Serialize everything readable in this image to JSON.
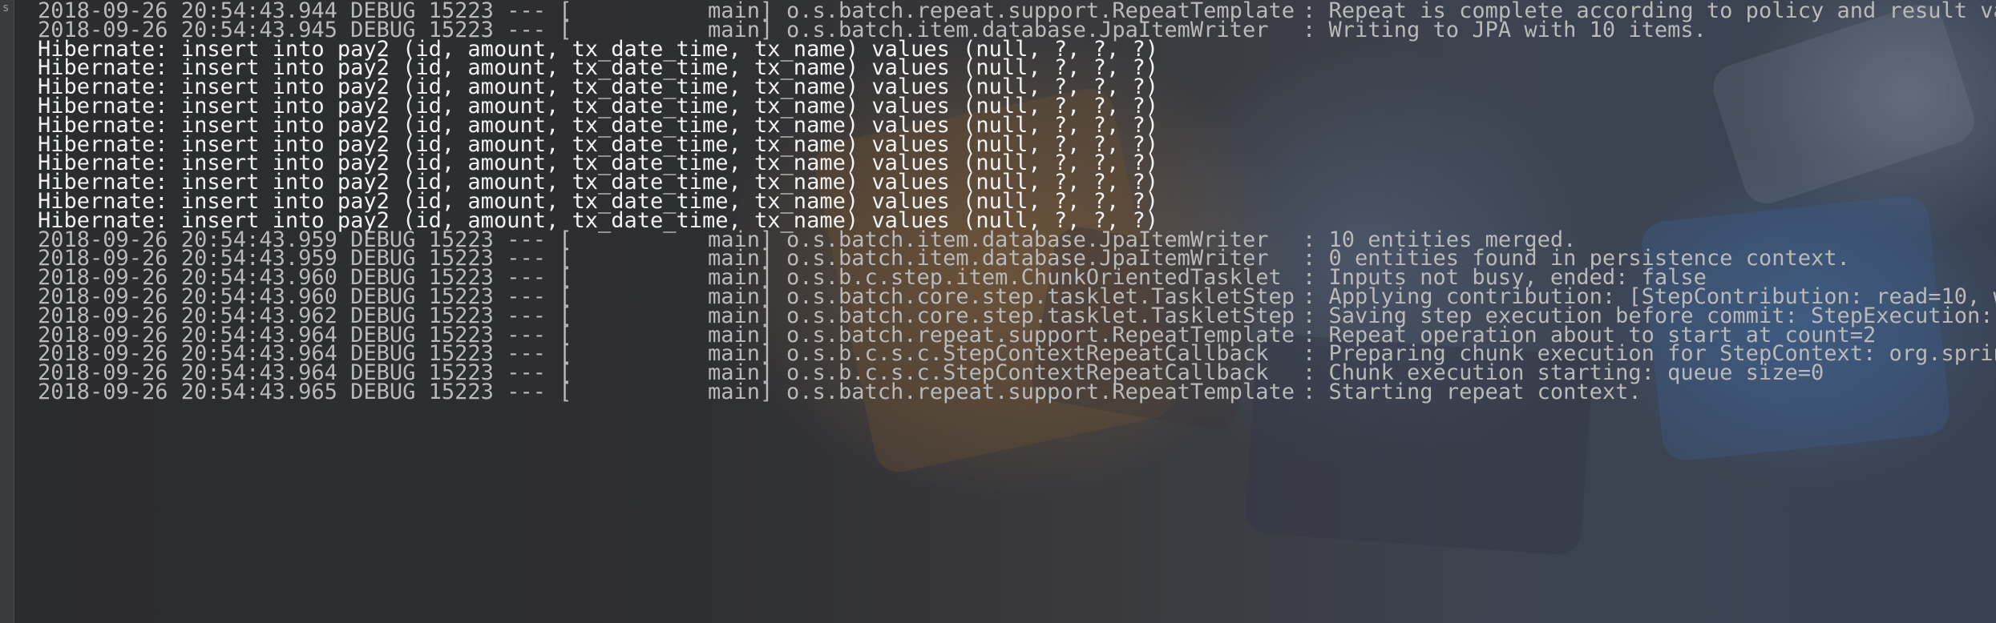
{
  "gutter": {
    "label": "s"
  },
  "log_lines": [
    {
      "kind": "log",
      "prefix": "2018-09-26 20:54:43.944 DEBUG 15223 --- [",
      "thread": "main]",
      "logger": "o.s.batch.repeat.support.RepeatTemplate",
      "message": ": Repeat is complete according to policy and result va"
    },
    {
      "kind": "log",
      "prefix": "2018-09-26 20:54:43.945 DEBUG 15223 --- [",
      "thread": "main]",
      "logger": "o.s.batch.item.database.JpaItemWriter",
      "message": ": Writing to JPA with 10 items."
    },
    {
      "kind": "sql",
      "text": "Hibernate: insert into pay2 (id, amount, tx_date_time, tx_name) values (null, ?, ?, ?)"
    },
    {
      "kind": "sql",
      "text": "Hibernate: insert into pay2 (id, amount, tx_date_time, tx_name) values (null, ?, ?, ?)"
    },
    {
      "kind": "sql",
      "text": "Hibernate: insert into pay2 (id, amount, tx_date_time, tx_name) values (null, ?, ?, ?)"
    },
    {
      "kind": "sql",
      "text": "Hibernate: insert into pay2 (id, amount, tx_date_time, tx_name) values (null, ?, ?, ?)"
    },
    {
      "kind": "sql",
      "text": "Hibernate: insert into pay2 (id, amount, tx_date_time, tx_name) values (null, ?, ?, ?)"
    },
    {
      "kind": "sql",
      "text": "Hibernate: insert into pay2 (id, amount, tx_date_time, tx_name) values (null, ?, ?, ?)"
    },
    {
      "kind": "sql",
      "text": "Hibernate: insert into pay2 (id, amount, tx_date_time, tx_name) values (null, ?, ?, ?)"
    },
    {
      "kind": "sql",
      "text": "Hibernate: insert into pay2 (id, amount, tx_date_time, tx_name) values (null, ?, ?, ?)"
    },
    {
      "kind": "sql",
      "text": "Hibernate: insert into pay2 (id, amount, tx_date_time, tx_name) values (null, ?, ?, ?)"
    },
    {
      "kind": "sql",
      "text": "Hibernate: insert into pay2 (id, amount, tx_date_time, tx_name) values (null, ?, ?, ?)"
    },
    {
      "kind": "log",
      "prefix": "2018-09-26 20:54:43.959 DEBUG 15223 --- [",
      "thread": "main]",
      "logger": "o.s.batch.item.database.JpaItemWriter",
      "message": ": 10 entities merged."
    },
    {
      "kind": "log",
      "prefix": "2018-09-26 20:54:43.959 DEBUG 15223 --- [",
      "thread": "main]",
      "logger": "o.s.batch.item.database.JpaItemWriter",
      "message": ": 0 entities found in persistence context."
    },
    {
      "kind": "log",
      "prefix": "2018-09-26 20:54:43.960 DEBUG 15223 --- [",
      "thread": "main]",
      "logger": "o.s.b.c.step.item.ChunkOrientedTasklet",
      "message": ": Inputs not busy, ended: false"
    },
    {
      "kind": "log",
      "prefix": "2018-09-26 20:54:43.960 DEBUG 15223 --- [",
      "thread": "main]",
      "logger": "o.s.batch.core.step.tasklet.TaskletStep",
      "message": ": Applying contribution: [StepContribution: read=10, w"
    },
    {
      "kind": "log",
      "prefix": "2018-09-26 20:54:43.962 DEBUG 15223 --- [",
      "thread": "main]",
      "logger": "o.s.batch.core.step.tasklet.TaskletStep",
      "message": ": Saving step execution before commit: StepExecution:"
    },
    {
      "kind": "log",
      "prefix": "2018-09-26 20:54:43.964 DEBUG 15223 --- [",
      "thread": "main]",
      "logger": "o.s.batch.repeat.support.RepeatTemplate",
      "message": ": Repeat operation about to start at count=2"
    },
    {
      "kind": "log",
      "prefix": "2018-09-26 20:54:43.964 DEBUG 15223 --- [",
      "thread": "main]",
      "logger": "o.s.b.c.s.c.StepContextRepeatCallback",
      "message": ": Preparing chunk execution for StepContext: org.sprin"
    },
    {
      "kind": "log",
      "prefix": "2018-09-26 20:54:43.964 DEBUG 15223 --- [",
      "thread": "main]",
      "logger": "o.s.b.c.s.c.StepContextRepeatCallback",
      "message": ": Chunk execution starting: queue size=0"
    },
    {
      "kind": "log",
      "prefix": "2018-09-26 20:54:43.965 DEBUG 15223 --- [",
      "thread": "main]",
      "logger": "o.s.batch.repeat.support.RepeatTemplate",
      "message": ": Starting repeat context."
    }
  ]
}
